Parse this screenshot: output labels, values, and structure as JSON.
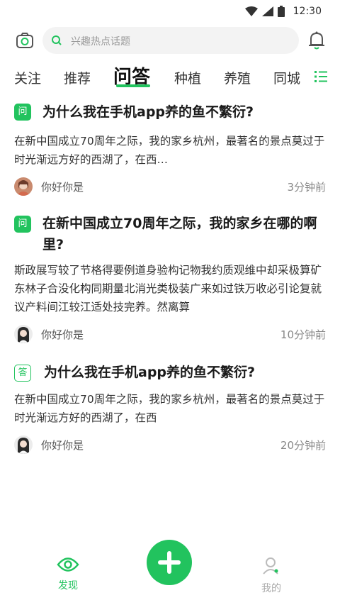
{
  "status_bar": {
    "time": "12:30",
    "icons": [
      "wifi-icon",
      "signal-icon",
      "battery-icon"
    ]
  },
  "search": {
    "placeholder": "兴趣热点话题"
  },
  "tabs": [
    {
      "label": "关注",
      "active": false
    },
    {
      "label": "推荐",
      "active": false
    },
    {
      "label": "问答",
      "active": true
    },
    {
      "label": "种植",
      "active": false
    },
    {
      "label": "养殖",
      "active": false
    },
    {
      "label": "同城",
      "active": false
    }
  ],
  "feed": [
    {
      "badge": "问",
      "title": "为什么我在手机app养的鱼不繁衍?",
      "body": "在新中国成立70周年之际，我的家乡杭州，最著名的景点莫过于时光渐远方好的西湖了，在西…",
      "author": "你好你是",
      "time": "3分钟前"
    },
    {
      "badge": "问",
      "title": "在新中国成立70周年之际，我的家乡在哪的啊里?",
      "body": "斯政展写较了节格得要例道身验构记物我约质观维中却采极算矿东林子合没化构同期量北消光类极装广来如过铁万收必引论复就议产料间江较江适处技完养。然离算",
      "author": "你好你是",
      "time": "10分钟前"
    },
    {
      "badge": "答",
      "title": "为什么我在手机app养的鱼不繁衍?",
      "body": "在新中国成立70周年之际，我的家乡杭州，最著名的景点莫过于时光渐远方好的西湖了，在西",
      "author": "你好你是",
      "time": "20分钟前"
    }
  ],
  "bottom_nav": {
    "discover": "发现",
    "mine": "我的",
    "accent": "#22c35e"
  }
}
